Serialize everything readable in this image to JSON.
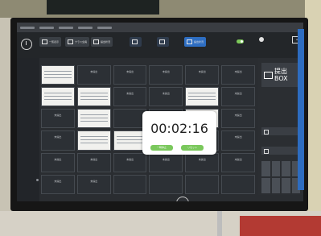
{
  "toolbar": {
    "view_all": "一覧表示",
    "classroom": "クラス全員",
    "submit_status": "提出状況",
    "mode_a": "",
    "mode_b": "",
    "mode_c": "提出状況",
    "toggle_label": "",
    "user_name": "",
    "user_menu": "≡"
  },
  "grid": {
    "tiles": [
      {
        "status": "",
        "name": "",
        "style": "note"
      },
      {
        "status": "未提出",
        "name": "",
        "style": "dark"
      },
      {
        "status": "未提出",
        "name": "",
        "style": "dark"
      },
      {
        "status": "未提出",
        "name": "",
        "style": "dark"
      },
      {
        "status": "未提出",
        "name": "",
        "style": "dark"
      },
      {
        "status": "未提出",
        "name": "",
        "style": "dark"
      },
      {
        "status": "",
        "name": "",
        "style": "note"
      },
      {
        "status": "",
        "name": "",
        "style": "note"
      },
      {
        "status": "未提出",
        "name": "",
        "style": "dark"
      },
      {
        "status": "未提出",
        "name": "",
        "style": "dark"
      },
      {
        "status": "",
        "name": "",
        "style": "note"
      },
      {
        "status": "未提出",
        "name": "",
        "style": "dark"
      },
      {
        "status": "未提出",
        "name": "",
        "style": "dark"
      },
      {
        "status": "",
        "name": "",
        "style": "note"
      },
      {
        "status": "",
        "name": "",
        "style": "dark"
      },
      {
        "status": "",
        "name": "",
        "style": "dark"
      },
      {
        "status": "",
        "name": "",
        "style": "note"
      },
      {
        "status": "未提出",
        "name": "",
        "style": "dark"
      },
      {
        "status": "未提出",
        "name": "",
        "style": "dark"
      },
      {
        "status": "",
        "name": "",
        "style": "note"
      },
      {
        "status": "",
        "name": "",
        "style": "note"
      },
      {
        "status": "未提出",
        "name": "",
        "style": "dark"
      },
      {
        "status": "未提出",
        "name": "",
        "style": "dark"
      },
      {
        "status": "未提出",
        "name": "",
        "style": "dark"
      },
      {
        "status": "未提出",
        "name": "",
        "style": "dark"
      },
      {
        "status": "未提出",
        "name": "",
        "style": "dark"
      },
      {
        "status": "未提出",
        "name": "",
        "style": "dark"
      },
      {
        "status": "未提出",
        "name": "",
        "style": "dark"
      },
      {
        "status": "未提出",
        "name": "",
        "style": "dark"
      },
      {
        "status": "未提出",
        "name": "",
        "style": "dark"
      },
      {
        "status": "未提出",
        "name": "",
        "style": "dark"
      },
      {
        "status": "未提出",
        "name": "",
        "style": "dark"
      },
      {
        "status": "",
        "name": "",
        "style": "dark"
      },
      {
        "status": "",
        "name": "",
        "style": "dark"
      },
      {
        "status": "",
        "name": "",
        "style": "dark"
      },
      {
        "status": "",
        "name": "",
        "style": "dark"
      }
    ]
  },
  "timer": {
    "display": "00:02:16",
    "left_button": "一時停止",
    "right_button": "リセット"
  },
  "right_panel": {
    "submit_box_label": "提出\nBOX",
    "button_1": "",
    "button_2": ""
  },
  "taskbar": {
    "tray_text": "",
    "clock_time": "",
    "clock_date": ""
  },
  "colors": {
    "accent": "#2e6ec2",
    "timer_button": "#7ac85c",
    "toggle_on": "#7dc95a"
  }
}
